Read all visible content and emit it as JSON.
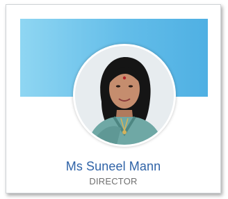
{
  "profile_card": {
    "name": "Ms Suneel Mann",
    "role": "DIRECTOR",
    "avatar": "avatar-photo"
  },
  "colors": {
    "banner_start": "#8fd6f2",
    "banner_end": "#4fb0e3",
    "name_text": "#2f63a7",
    "role_text": "#6f6f6f"
  }
}
